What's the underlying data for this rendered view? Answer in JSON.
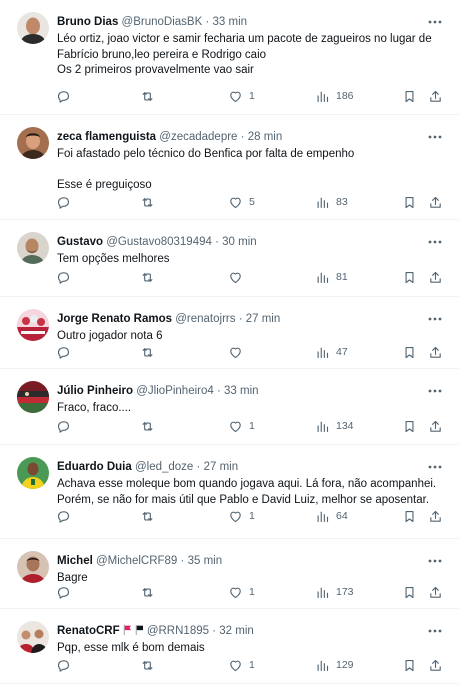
{
  "replies": [
    {
      "name": "Bruno Dias",
      "handle": "@BrunoDiasBK",
      "sep": "·",
      "time": "33 min",
      "text": "Léo ortiz, joao victor e samir fecharia um pacote de zagueiros no lugar de Fabrício bruno,leo pereira e Rodrigo caio\nOs 2 primeiros provavelmente vao sair",
      "likes": "1",
      "views": "186",
      "avatar_icon": "profile-photo-man-bald"
    },
    {
      "name": "zeca flamenguista",
      "handle": "@zecadadepre",
      "sep": "·",
      "time": "28 min",
      "text": "Foi afastado pelo técnico do Benfica por falta de empenho\n\nEsse é preguiçoso",
      "likes": "5",
      "views": "83",
      "avatar_icon": "profile-photo-man"
    },
    {
      "name": "Gustavo",
      "handle": "@Gustavo80319494",
      "sep": "·",
      "time": "30 min",
      "text": "Tem opções melhores",
      "likes": "",
      "views": "81",
      "avatar_icon": "profile-photo-man-beard"
    },
    {
      "name": "Jorge Renato Ramos",
      "handle": "@renatojrrs",
      "sep": "·",
      "time": "27 min",
      "text": "Outro jogador nota 6",
      "likes": "",
      "views": "47",
      "avatar_icon": "profile-photo-crowd"
    },
    {
      "name": "Júlio Pinheiro",
      "handle": "@JlioPinheiro4",
      "sep": "·",
      "time": "33 min",
      "text": "Fraco, fraco....",
      "likes": "1",
      "views": "134",
      "avatar_icon": "profile-photo-stadium"
    },
    {
      "name": "Eduardo Duia",
      "handle": "@led_doze",
      "sep": "·",
      "time": "27 min",
      "text": "Achava esse moleque bom quando jogava aqui. Lá fora, não acompanhei. Porém, se não for mais útil que Pablo e David Luiz, melhor se aposentar.",
      "likes": "1",
      "views": "64",
      "avatar_icon": "profile-photo-player-yellow"
    },
    {
      "name": "Michel",
      "handle": "@MichelCRF89",
      "sep": "·",
      "time": "35 min",
      "text": "Bagre",
      "likes": "1",
      "views": "173",
      "avatar_icon": "profile-photo-man-red"
    },
    {
      "name": "RenatoCRF",
      "handle": "@RRN1895",
      "sep": "·",
      "time": "32 min",
      "text": "Pqp, esse mlk é bom demais",
      "likes": "1",
      "views": "129",
      "avatar_icon": "profile-photo-group",
      "flags": [
        "red-flag-icon",
        "black-flag-icon"
      ]
    }
  ],
  "colors": {
    "text": "#0f1419",
    "secondary": "#536471",
    "divider": "#eff3f4",
    "flag_red": "#e0245e",
    "flag_black": "#0f1419"
  }
}
